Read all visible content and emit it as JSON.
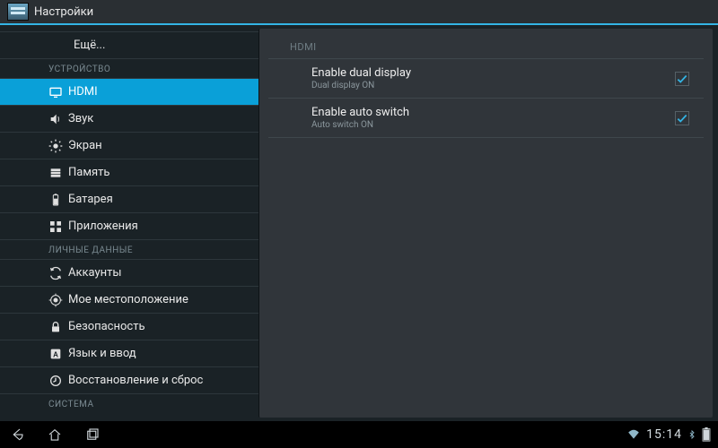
{
  "actionbar": {
    "title": "Настройки"
  },
  "sidebar": {
    "more_label": "Ещё...",
    "cat_device": "УСТРОЙСТВО",
    "cat_personal": "ЛИЧНЫЕ ДАННЫЕ",
    "cat_system": "СИСТЕМА",
    "items": {
      "hdmi": "HDMI",
      "sound": "Звук",
      "display": "Экран",
      "storage": "Память",
      "battery": "Батарея",
      "apps": "Приложения",
      "accounts": "Аккаунты",
      "location": "Мое местоположение",
      "security": "Безопасность",
      "language": "Язык и ввод",
      "backup": "Восстановление и сброс"
    }
  },
  "detail": {
    "header": "HDMI",
    "rows": [
      {
        "title": "Enable dual display",
        "sub": "Dual display ON",
        "checked": true
      },
      {
        "title": "Enable auto switch",
        "sub": "Auto switch ON",
        "checked": true
      }
    ]
  },
  "statusbar": {
    "time": "15:14"
  }
}
